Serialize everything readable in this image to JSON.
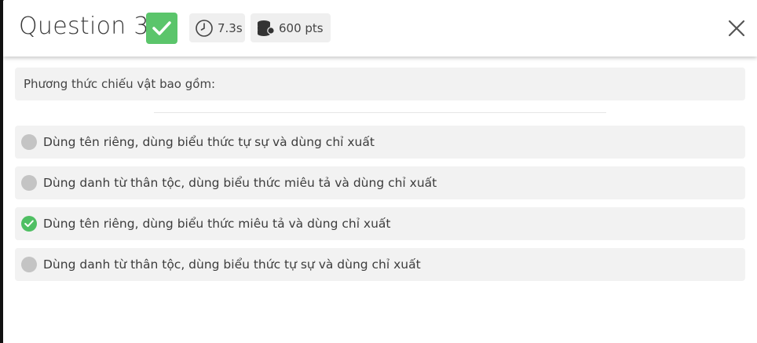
{
  "header": {
    "title": "Question 3",
    "status_icon": "check-icon",
    "time": {
      "icon": "clock-icon",
      "label": "7.3s"
    },
    "points": {
      "icon": "coins-icon",
      "label": "600 pts"
    },
    "close_icon": "close-icon"
  },
  "question": {
    "prompt": "Phương thức chiếu vật bao gồm:"
  },
  "options": [
    {
      "label": "Dùng tên riêng, dùng biểu thức tự sự và dùng chỉ xuất",
      "correct": false
    },
    {
      "label": "Dùng danh từ thân tộc, dùng biểu thức miêu tả và dùng chỉ xuất",
      "correct": false
    },
    {
      "label": "Dùng tên riêng, dùng biểu thức miêu tả và dùng chỉ xuất",
      "correct": true
    },
    {
      "label": "Dùng danh từ thân tộc, dùng biểu thức tự sự và dùng chỉ xuất",
      "correct": false
    }
  ],
  "colors": {
    "correct_green": "#5bc56b",
    "neutral_radio": "#c4c4c4",
    "option_bg": "#f2f2f2"
  }
}
